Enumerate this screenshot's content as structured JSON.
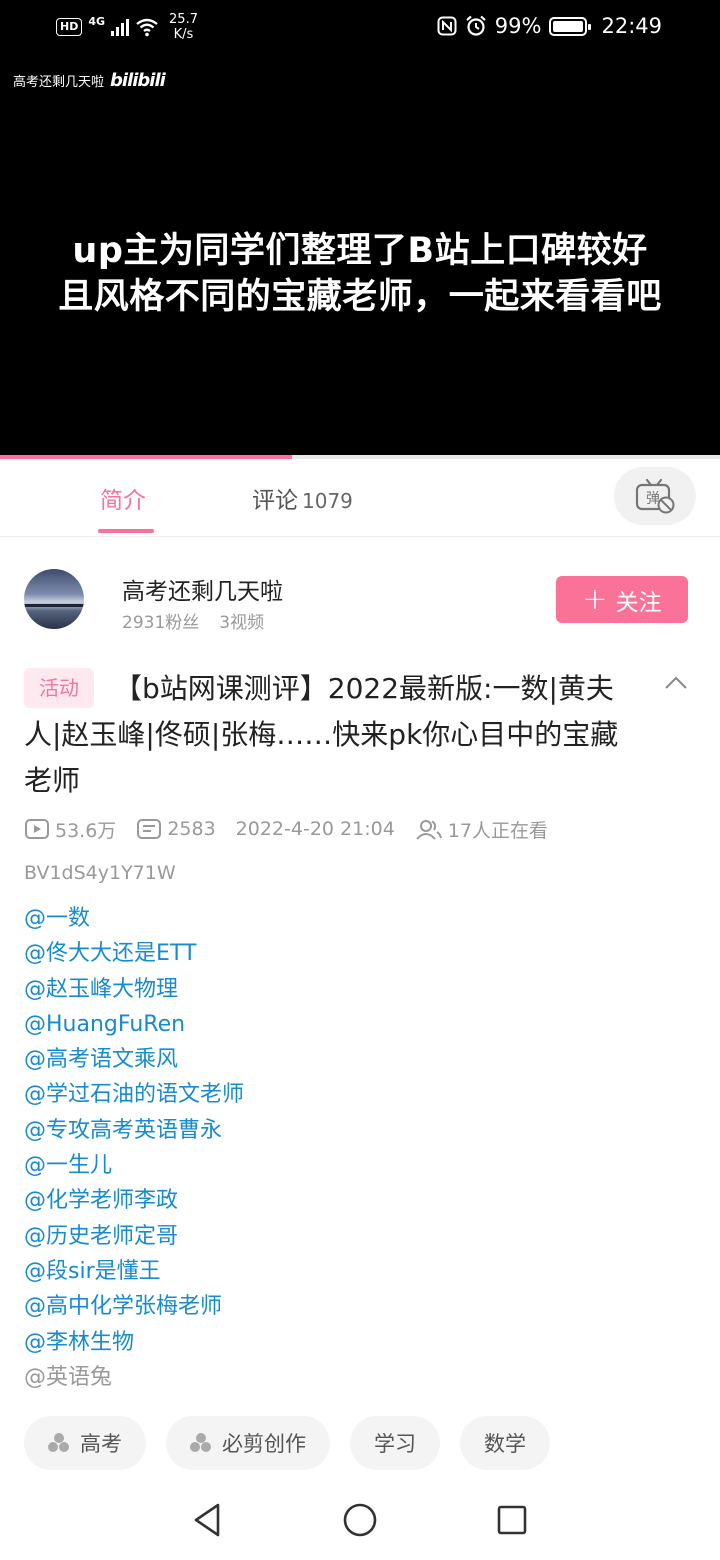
{
  "status_bar": {
    "network_badge": "HD",
    "signal_label": "4G",
    "speed_value": "25.7",
    "speed_unit": "K/s",
    "battery_percent": "99%",
    "time": "22:49"
  },
  "video": {
    "watermark_text": "高考还剩几天啦",
    "watermark_logo": "bilibili",
    "caption_lines": [
      "up主为同学们整理了B站上口碑较好",
      "且风格不同的宝藏老师，一起来看看吧"
    ],
    "progress_fraction": 0.405
  },
  "tabs": {
    "intro_label": "简介",
    "comments_label": "评论",
    "comments_count": "1079",
    "danmaku_icon_text": "弹"
  },
  "uploader": {
    "name": "高考还剩几天啦",
    "fans": "2931粉丝",
    "videos": "3视频",
    "follow_label": "关注"
  },
  "video_info": {
    "badge": "活动",
    "title": "【b站网课测评】2022最新版:一数|黄夫人|赵玉峰|佟硕|张梅……快来pk你心目中的宝藏老师",
    "views": "53.6万",
    "danmaku_count": "2583",
    "publish_time": "2022-4-20 21:04",
    "watching": "17人正在看",
    "bvid": "BV1dS4y1Y71W"
  },
  "mentions": [
    "@一数",
    "@佟大大还是ETT",
    "@赵玉峰大物理",
    "@HuangFuRen",
    "@高考语文乘风",
    "@学过石油的语文老师",
    "@专攻高考英语曹永",
    "@一生儿",
    "@化学老师李政",
    "@历史老师定哥",
    "@段sir是懂王",
    "@高中化学张梅老师",
    "@李林生物",
    "@英语兔"
  ],
  "tags": [
    {
      "label": "高考",
      "icon": "topic-icon"
    },
    {
      "label": "必剪创作",
      "icon": "topic-icon"
    },
    {
      "label": "学习"
    },
    {
      "label": "数学"
    }
  ],
  "colors": {
    "accent": "#fb7299",
    "mention_link": "#178bcf",
    "meta_gray": "#999999"
  }
}
